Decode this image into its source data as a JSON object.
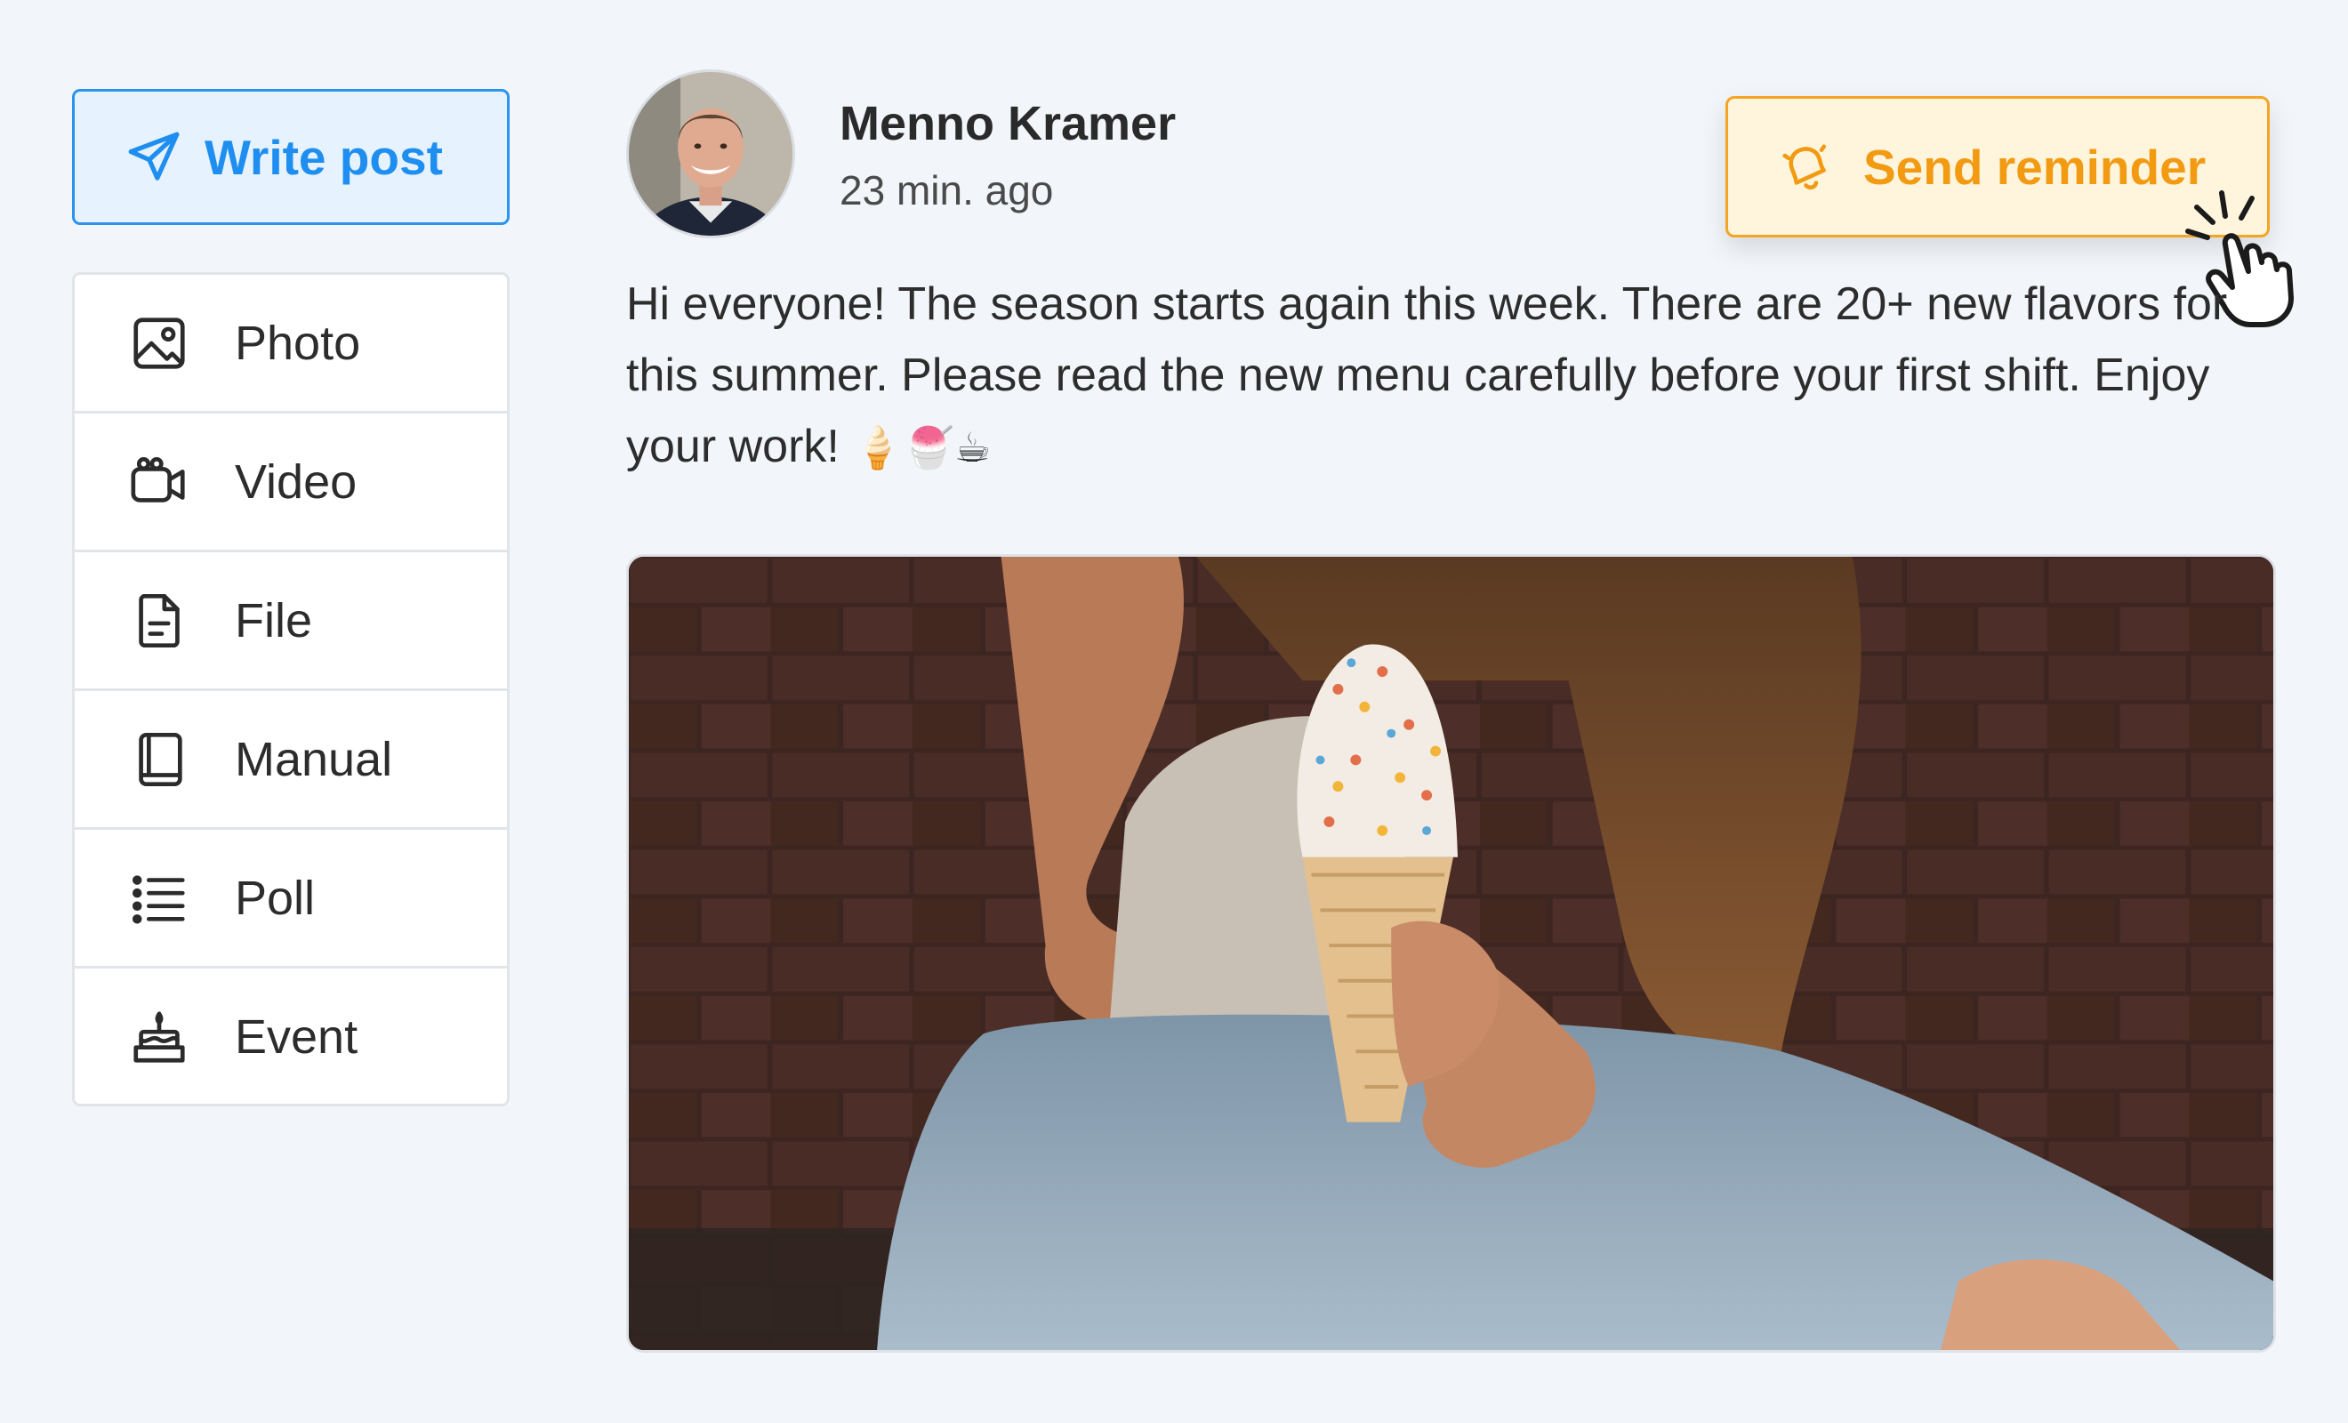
{
  "sidebar": {
    "write_post": {
      "label": "Write post",
      "icon": "send-icon"
    },
    "items": [
      {
        "label": "Photo",
        "icon": "image-icon"
      },
      {
        "label": "Video",
        "icon": "video-camera-icon"
      },
      {
        "label": "File",
        "icon": "file-icon"
      },
      {
        "label": "Manual",
        "icon": "book-icon"
      },
      {
        "label": "Poll",
        "icon": "list-icon"
      },
      {
        "label": "Event",
        "icon": "cake-icon"
      }
    ]
  },
  "post": {
    "author": "Menno Kramer",
    "time": "23 min. ago",
    "text": "Hi everyone! The season starts again this week. There are 20+ new flavors for this summer. Please read the new menu carefully before your first shift. Enjoy your work!",
    "emojis": "🍦🍧☕",
    "reminder_button": {
      "label": "Send reminder",
      "icon": "bell-icon"
    }
  },
  "colors": {
    "accent_blue": "#1f8ef1",
    "accent_orange": "#f29a12",
    "background": "#f2f6fa"
  }
}
